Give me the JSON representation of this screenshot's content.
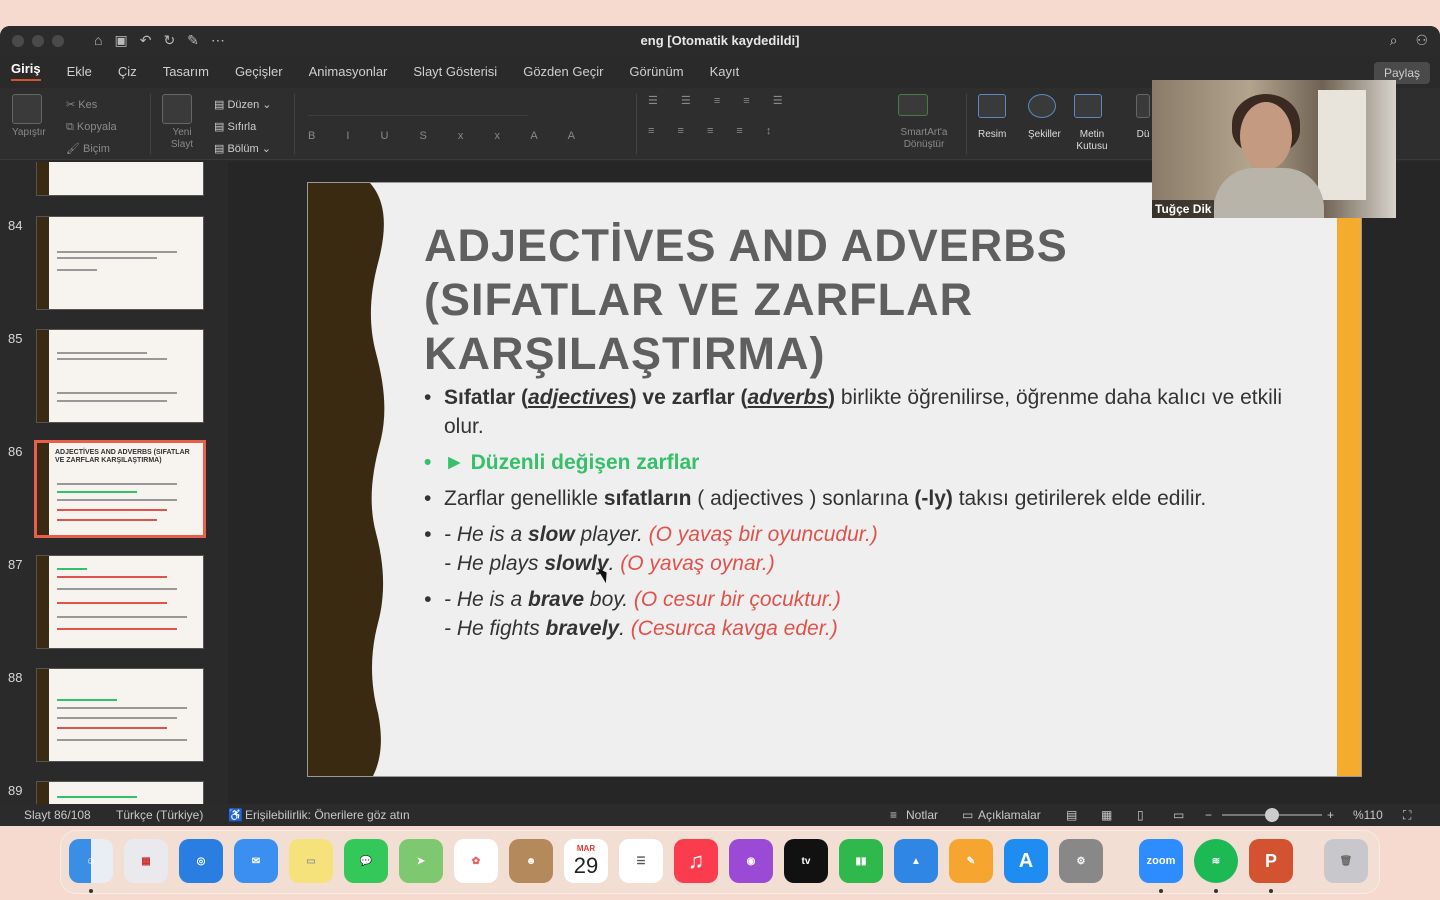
{
  "window": {
    "title": "eng [Otomatik kaydedildi]"
  },
  "tabs": [
    "Giriş",
    "Ekle",
    "Çiz",
    "Tasarım",
    "Geçişler",
    "Animasyonlar",
    "Slayt Gösterisi",
    "Gözden Geçir",
    "Görünüm",
    "Kayıt"
  ],
  "share_label": "Paylaş",
  "ribbon": {
    "paste": "Yapıştır",
    "cut": "Kes",
    "copy": "Kopyala",
    "format": "Biçim",
    "new_slide": "Yeni Slayt",
    "layout": "Düzen",
    "reset": "Sıfırla",
    "section": "Bölüm",
    "smartart": "SmartArt'a Dönüştür",
    "picture": "Resim",
    "shapes": "Şekiller",
    "textbox": "Metin Kutusu",
    "draw": "Dü"
  },
  "slides": [
    {
      "num": "84"
    },
    {
      "num": "85"
    },
    {
      "num": "86",
      "title": "ADJECTİVES AND ADVERBS (SIFATLAR VE ZARFLAR KARŞILAŞTIRMA)"
    },
    {
      "num": "87"
    },
    {
      "num": "88"
    },
    {
      "num": "89"
    }
  ],
  "slide": {
    "title": "ADJECTİVES AND ADVERBS (SIFATLAR VE ZARFLAR KARŞILAŞTIRMA)",
    "b1_a": "Sıfatlar (",
    "b1_b": "adjectives",
    "b1_c": ") ve ",
    "b1_d": "zarflar (",
    "b1_e": "adverbs",
    "b1_f": ")",
    "b1_g": " birlikte öğrenilirse, öğrenme daha kalıcı ve etkili olur.",
    "b2": "► Düzenli değişen zarflar",
    "b3_a": "Zarflar genellikle ",
    "b3_b": "sıfatların",
    "b3_c": " ( adjectives ) sonlarına ",
    "b3_d": "(-ly)",
    "b3_e": " takısı getirilerek elde edilir.",
    "ex1_a": "- He is a ",
    "ex1_b": "slow",
    "ex1_c": " player. ",
    "ex1_d": "(O yavaş bir oyuncudur.)",
    "ex2_a": "- He plays ",
    "ex2_b": "slowly",
    "ex2_c": ". ",
    "ex2_d": "(O yavaş oynar.)",
    "ex3_a": "- He is a ",
    "ex3_b": "brave",
    "ex3_c": " boy. ",
    "ex3_d": "(O cesur bir çocuktur.)",
    "ex4_a": "- He fights ",
    "ex4_b": "bravely",
    "ex4_c": ". ",
    "ex4_d": "(Cesurca kavga eder.)"
  },
  "status": {
    "slide_pos": "Slayt 86/108",
    "language": "Türkçe (Türkiye)",
    "accessibility": "Erişilebilirlik: Önerilere göz atın",
    "notes": "Notlar",
    "comments": "Açıklamalar",
    "zoom": "%110"
  },
  "video": {
    "name": "Tuğçe Dik"
  },
  "calendar": {
    "month": "MAR",
    "day": "29"
  },
  "zoom_app": "zoom",
  "colors": {
    "accent": "#d35230",
    "slide_band": "#3a2a12",
    "orange_bar": "#f4ab2e",
    "green": "#35c06a",
    "red": "#e0524c"
  }
}
